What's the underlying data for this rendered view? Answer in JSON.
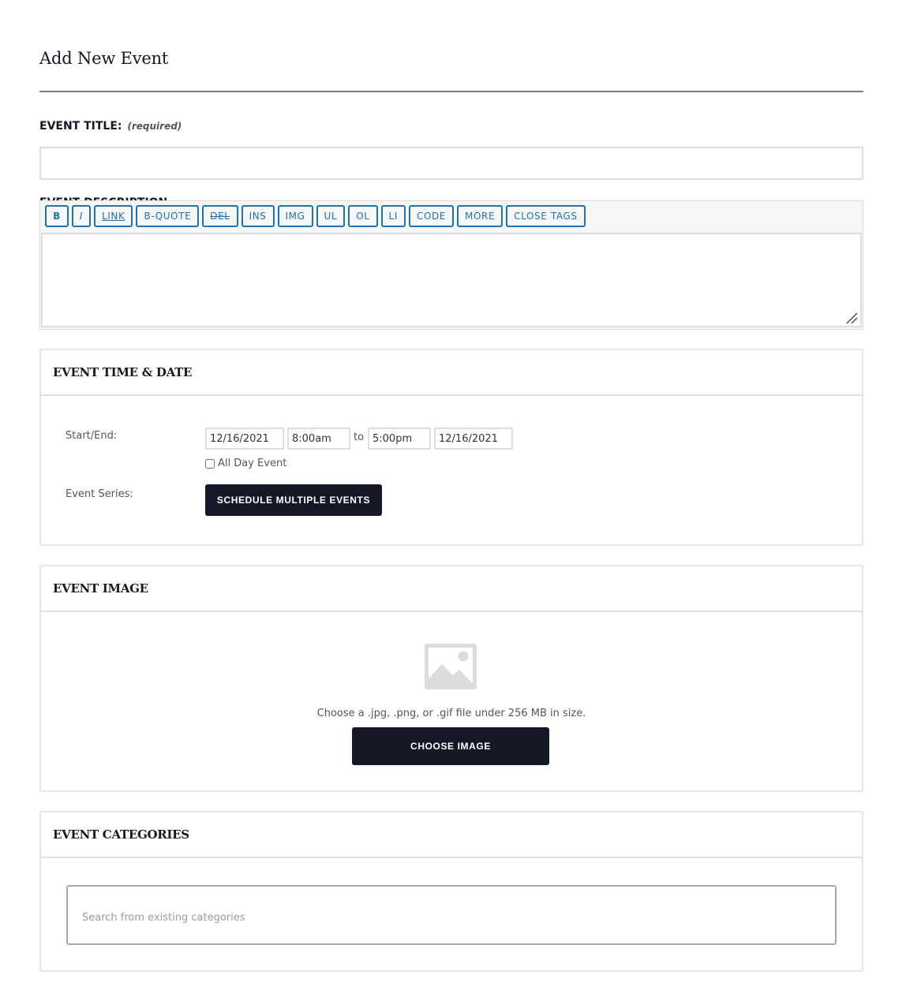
{
  "page": {
    "title": "Add New Event"
  },
  "event_title": {
    "label": "EVENT TITLE:",
    "required_note": "(required)",
    "value": ""
  },
  "event_description": {
    "label": "EVENT DESCRIPTION",
    "value": "",
    "toolbar": [
      {
        "id": "b",
        "label": "B"
      },
      {
        "id": "i",
        "label": "I"
      },
      {
        "id": "link",
        "label": "LINK"
      },
      {
        "id": "b-quote",
        "label": "B-QUOTE"
      },
      {
        "id": "del",
        "label": "DEL"
      },
      {
        "id": "ins",
        "label": "INS"
      },
      {
        "id": "img",
        "label": "IMG"
      },
      {
        "id": "ul",
        "label": "UL"
      },
      {
        "id": "ol",
        "label": "OL"
      },
      {
        "id": "li",
        "label": "LI"
      },
      {
        "id": "code",
        "label": "CODE"
      },
      {
        "id": "more",
        "label": "MORE"
      },
      {
        "id": "close-tags",
        "label": "CLOSE TAGS"
      }
    ]
  },
  "time_date": {
    "heading": "EVENT TIME & DATE",
    "start_end_label": "Start/End:",
    "start_date": "12/16/2021",
    "start_time": "8:00am",
    "to_text": "to",
    "end_time": "5:00pm",
    "end_date": "12/16/2021",
    "all_day_label": "All Day Event",
    "all_day_checked": false,
    "series_label": "Event Series:",
    "schedule_button": "SCHEDULE MULTIPLE EVENTS"
  },
  "image": {
    "heading": "EVENT IMAGE",
    "placeholder_icon": "image-placeholder-icon",
    "hint": "Choose a .jpg, .png, or .gif file under 256 MB in size.",
    "choose_button": "CHOOSE IMAGE"
  },
  "categories": {
    "heading": "EVENT CATEGORIES",
    "search_placeholder": "Search from existing categories",
    "search_value": ""
  },
  "colors": {
    "text_dark": "#141827",
    "button_dark": "#141827",
    "toolbar_accent": "#2271b1",
    "border_light": "#dcdcdc"
  }
}
